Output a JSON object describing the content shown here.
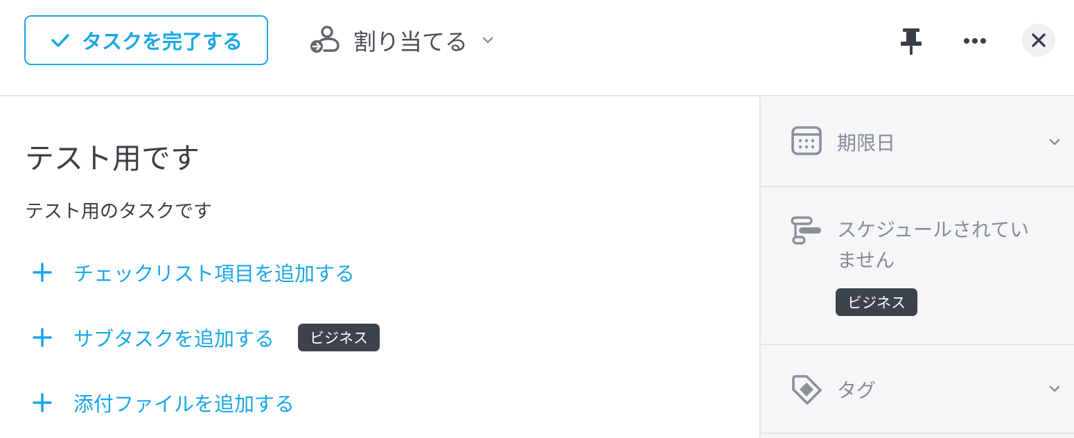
{
  "header": {
    "complete_label": "タスクを完了する",
    "assign_label": "割り当てる"
  },
  "task": {
    "title": "テスト用です",
    "description": "テスト用のタスクです",
    "add_actions": [
      {
        "label": "チェックリスト項目を追加する"
      },
      {
        "label": "サブタスクを追加する",
        "badge": "ビジネス"
      },
      {
        "label": "添付ファイルを追加する"
      }
    ]
  },
  "sidebar": {
    "due_date_label": "期限日",
    "schedule_label_line1": "スケジュールされてい",
    "schedule_label_line2": "ません",
    "schedule_badge": "ビジネス",
    "tags_label": "タグ"
  },
  "colors": {
    "accent": "#1aa7e8",
    "badge_bg": "#3d434a",
    "sidebar_bg": "#f5f6f7",
    "muted_text": "#868c92"
  },
  "icons": {
    "complete": "check-icon",
    "assign": "assign-user-icon",
    "pin": "pin-icon",
    "more": "more-dots-icon",
    "close": "close-icon",
    "due_date": "calendar-icon",
    "schedule": "schedule-icon",
    "tags": "tag-icon"
  }
}
